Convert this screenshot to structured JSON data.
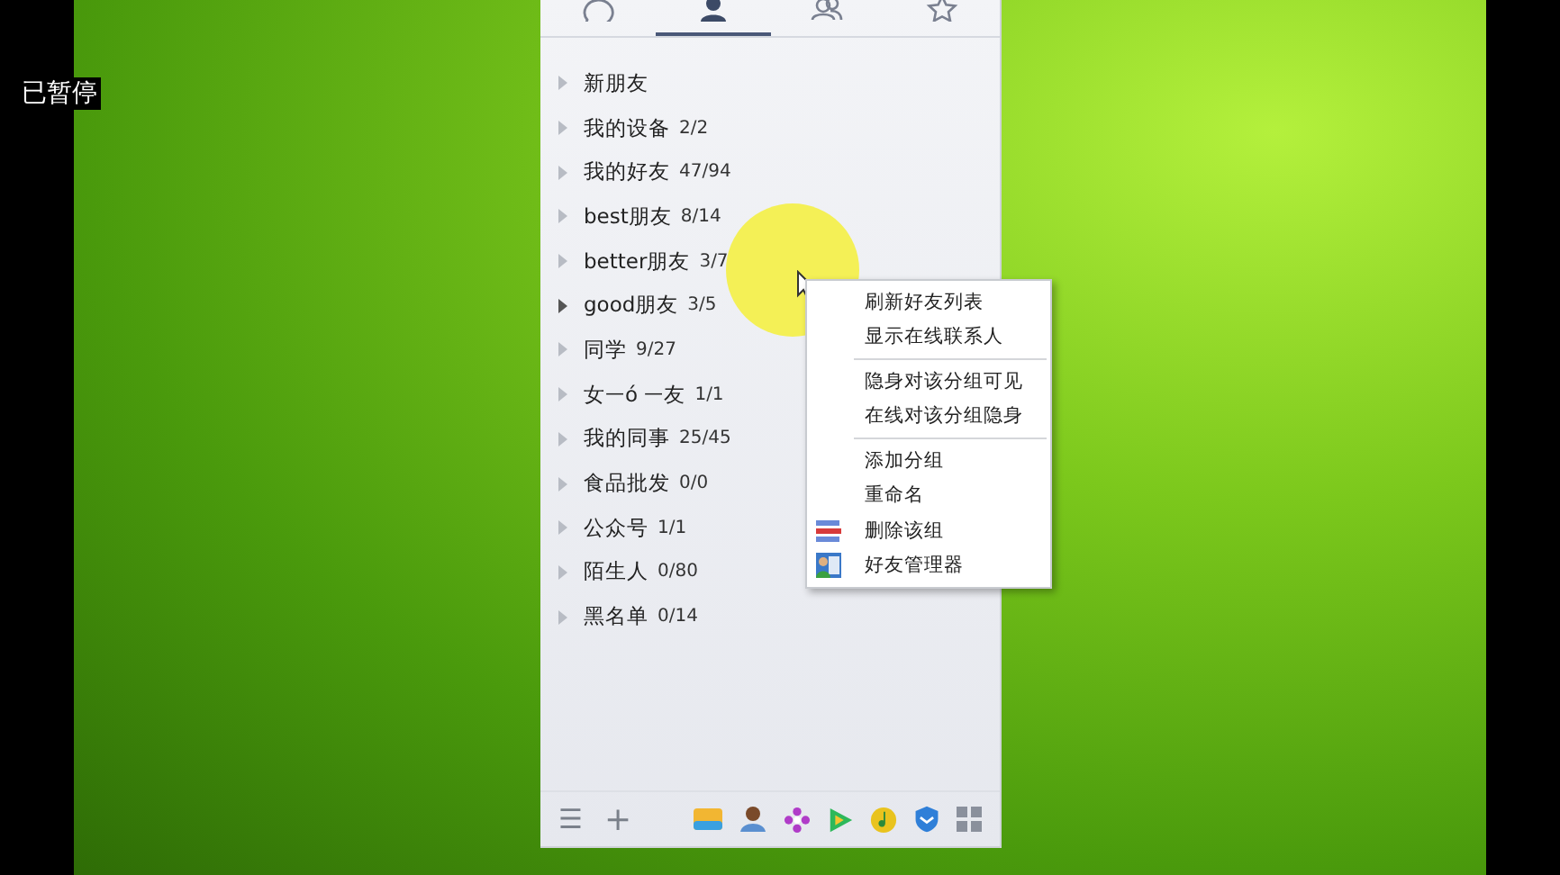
{
  "player_status": "已暂停",
  "tabs": [
    {
      "kind": "chat",
      "selected": false
    },
    {
      "kind": "contact",
      "selected": true
    },
    {
      "kind": "group",
      "selected": false
    },
    {
      "kind": "star",
      "selected": false
    }
  ],
  "groups": [
    {
      "name": "新朋友",
      "hovered": false
    },
    {
      "name": "我的设备",
      "count": "2/2",
      "hovered": false
    },
    {
      "name": "我的好友",
      "count": "47/94",
      "hovered": false
    },
    {
      "name": "best朋友",
      "count": "8/14",
      "hovered": false
    },
    {
      "name": "better朋友",
      "count": "3/7",
      "hovered": false
    },
    {
      "name": "good朋友",
      "count": "3/5",
      "hovered": true
    },
    {
      "name": "同学",
      "count": "9/27",
      "hovered": false
    },
    {
      "name": "女ᅳó ᅳ友",
      "count": "1/1",
      "hovered": false
    },
    {
      "name": "我的同事",
      "count": "25/45",
      "hovered": false
    },
    {
      "name": "食品批发",
      "count": "0/0",
      "hovered": false
    },
    {
      "name": "公众号",
      "count": "1/1",
      "hovered": false
    },
    {
      "name": "陌生人",
      "count": "0/80",
      "hovered": false
    },
    {
      "name": "黑名单",
      "count": "0/14",
      "hovered": false
    }
  ],
  "context_menu": [
    [
      {
        "label": "刷新好友列表",
        "kind": "text"
      },
      {
        "label": "显示在线联系人",
        "kind": "text"
      }
    ],
    [
      {
        "label": "隐身对该分组可见",
        "kind": "text"
      },
      {
        "label": "在线对该分组隐身",
        "kind": "text"
      }
    ],
    [
      {
        "label": "添加分组",
        "kind": "text"
      },
      {
        "label": "重命名",
        "kind": "text"
      },
      {
        "label": "删除该组",
        "kind": "delete"
      },
      {
        "label": "好友管理器",
        "kind": "manager"
      }
    ]
  ],
  "footer": {
    "menu_glyph": "☰",
    "add_glyph": "+"
  }
}
